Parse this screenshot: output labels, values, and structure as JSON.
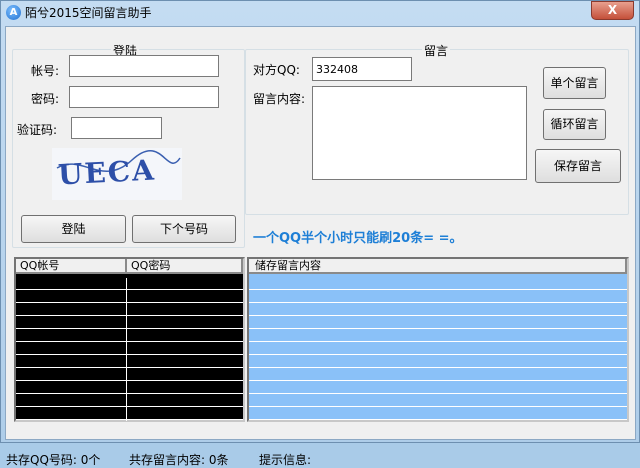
{
  "window": {
    "title": "陌兮2015空间留言助手",
    "close_label": "X",
    "app_icon": "A"
  },
  "login": {
    "group_title": "登陆",
    "account_label": "帐号:",
    "account_value": "",
    "password_label": "密码:",
    "password_value": "",
    "captcha_label": "验证码:",
    "captcha_value": "",
    "captcha_text": "UECA",
    "login_button": "登陆",
    "next_button": "下个号码"
  },
  "message": {
    "group_title": "留言",
    "target_label": "对方QQ:",
    "target_value": "332408",
    "content_label": "留言内容:",
    "content_value": "",
    "single_button": "单个留言",
    "loop_button": "循环留言",
    "save_button": "保存留言"
  },
  "hint": "一个QQ半个小时只能刷20条= =。",
  "accounts_table": {
    "columns": [
      "QQ帐号",
      "QQ密码"
    ],
    "row_count": 11,
    "row_color": "#000000"
  },
  "messages_table": {
    "columns": [
      "储存留言内容"
    ],
    "row_count": 11,
    "row_color": "#8ac1f8"
  },
  "status": {
    "qq_count": "共存QQ号码: 0个",
    "msg_count": "共存留言内容: 0条",
    "info": "提示信息:"
  }
}
